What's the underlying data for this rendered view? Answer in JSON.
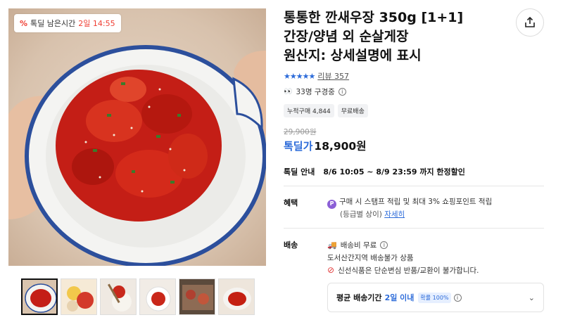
{
  "gallery": {
    "deal_badge": {
      "icon": "percent-icon",
      "label": "톡딜 남은시간",
      "time": "2일 14:55"
    },
    "thumbnail_count": 6
  },
  "product": {
    "title_line1": "통통한 깐새우장 350g [1+1]",
    "title_line2": "간장/양념 외 순살게장",
    "title_line3": "원산지: 상세설명에 표시",
    "rating_stars": 5,
    "review_text": "리뷰 357",
    "viewers_text": "33명 구경중",
    "tags": [
      "누적구매 4,844",
      "무료배송"
    ],
    "original_price": "29,900원",
    "price_label": "톡딜가",
    "price": "18,900원",
    "notice_label": "톡딜 안내",
    "notice_text": "8/6 10:05 ~ 8/9 23:59 까지 한정할인"
  },
  "benefit": {
    "label": "혜택",
    "line1": "구매 시 스탬프 적립 및 최대 3% 쇼핑포인트 적립",
    "line2": "(등급별 상이)",
    "link": "자세히"
  },
  "shipping": {
    "label": "배송",
    "fee": "배송비 무료",
    "note": "도서산간지역 배송불가 상품",
    "warning": "신선식품은 단순변심 반품/교환이 불가합니다.",
    "delivery_label": "평균 배송기간",
    "delivery_value": "2일 이내",
    "delivery_chip": "확률 100%"
  },
  "colors": {
    "accent": "#2c6bd9",
    "deal_red": "#ef3e33",
    "point_purple": "#8b5fd6"
  }
}
